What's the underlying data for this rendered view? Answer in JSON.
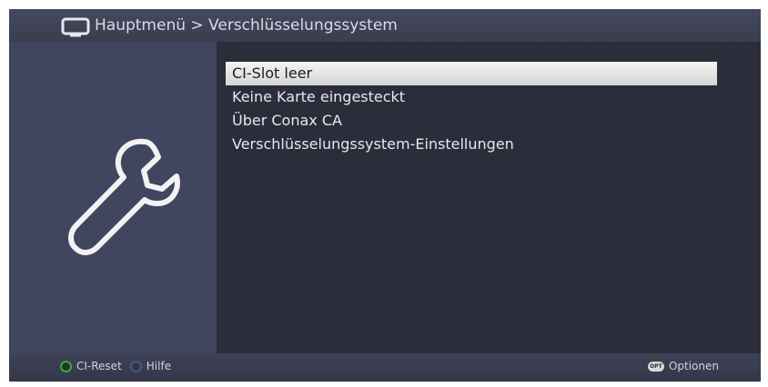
{
  "header": {
    "breadcrumb": "Hauptmenü > Verschlüsselungssystem",
    "icon": "tv-icon"
  },
  "sidebar": {
    "icon": "wrench-icon"
  },
  "menu": {
    "items": [
      {
        "label": "CI-Slot  leer",
        "selected": true
      },
      {
        "label": "Keine Karte eingesteckt",
        "selected": false
      },
      {
        "label": "Über Conax CA",
        "selected": false
      },
      {
        "label": "Verschlüsselungssystem-Einstellungen",
        "selected": false
      }
    ]
  },
  "footer": {
    "ci_reset_label": "CI-Reset",
    "help_label": "Hilfe",
    "opt_icon_text": "OPT",
    "options_label": "Optionen"
  },
  "colors": {
    "background": "#2b2d3a",
    "sidebar": "#40465f",
    "header": "#3a3d4f",
    "selection": "#e8e8e8",
    "green_key": "#3ea83a",
    "blue_key": "#4a5a7a"
  }
}
